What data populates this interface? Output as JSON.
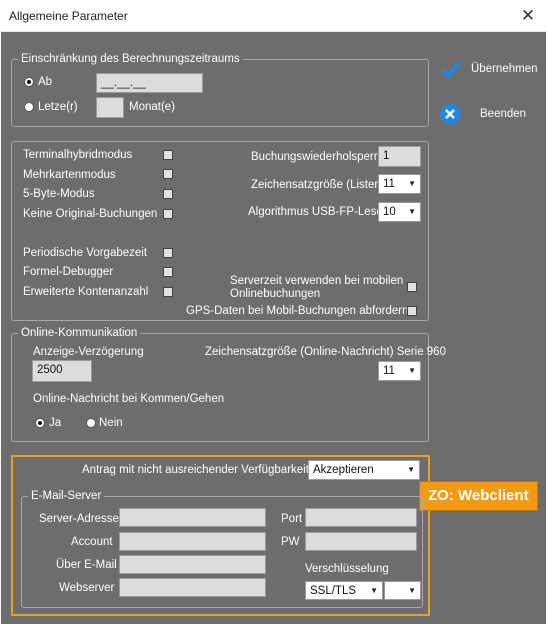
{
  "window": {
    "title": "Allgemeine Parameter",
    "close_glyph": "✕"
  },
  "actions": {
    "apply_label": "Übernehmen",
    "exit_label": "Beenden"
  },
  "period": {
    "legend": "Einschränkung des Berechnungszeitraums",
    "ab_label": "Ab",
    "ab_value": "__.__.__",
    "letzte_label": "Letze(r)",
    "monat_label": "Monat(e)",
    "monat_value": ""
  },
  "modes": {
    "terminalhybrid": "Terminalhybridmodus",
    "mehrkarten": "Mehrkartenmodus",
    "five_byte": "5-Byte-Modus",
    "keine_original": "Keine Original-Buchungen",
    "periodische": "Periodische Vorgabezeit",
    "formel_debugger": "Formel-Debugger",
    "erweiterte_konten": "Erweiterte Kontenanzahl",
    "buchungswiederholsperre_label": "Buchungswiederholsperre",
    "buchungswiederholsperre_value": "1",
    "zeichensatz_listen_label": "Zeichensatzgröße (Listen)",
    "zeichensatz_listen_value": "11",
    "algorithmus_label": "Algorithmus USB-FP-Leser",
    "algorithmus_value": "10",
    "serverzeit_line1": "Serverzeit verwenden bei mobilen",
    "serverzeit_line2": "Onlinebuchungen",
    "gps_label": "GPS-Daten bei Mobil-Buchungen abfordern"
  },
  "online": {
    "legend": "Online-Kommunikation",
    "anzeige_label": "Anzeige-Verzögerung",
    "anzeige_value": "2500",
    "zeichensatz_label": "Zeichensatzgröße (Online-Nachricht) Serie 960",
    "zeichensatz_value": "11",
    "kommen_label": "Online-Nachricht bei Kommen/Gehen",
    "ja_label": "Ja",
    "nein_label": "Nein"
  },
  "webclient": {
    "antrag_label": "Antrag mit nicht ausreichender Verfügbarkeit",
    "antrag_value": "Akzeptieren",
    "badge": "ZO: Webclient",
    "email_legend": "E-Mail-Server",
    "server_label": "Server-Adresse",
    "account_label": "Account",
    "ueber_label": "Über E-Mail",
    "webserver_label": "Webserver",
    "port_label": "Port",
    "pw_label": "PW",
    "verschl_label": "Verschlüsselung",
    "verschl_value": "SSL/TLS",
    "verschl_value2": ""
  },
  "colors": {
    "background": "#6d6d6d",
    "highlight": "#f29a12",
    "check_accent": "#1e88e5"
  }
}
